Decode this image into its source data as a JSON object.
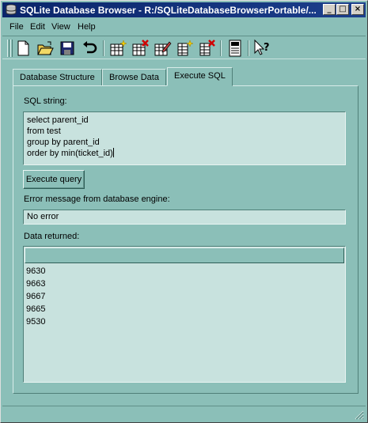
{
  "window": {
    "title": "SQLite Database Browser - R:/SQLiteDatabaseBrowserPortable/..."
  },
  "title_buttons": {
    "minimize": "_",
    "maximize": "□",
    "close": "×"
  },
  "menu": [
    "File",
    "Edit",
    "View",
    "Help"
  ],
  "toolbar": {
    "icons": [
      "new-database-icon",
      "open-database-icon",
      "save-icon",
      "undo-icon",
      "create-table-icon",
      "delete-table-icon",
      "modify-table-icon",
      "create-index-icon",
      "delete-index-icon",
      "log-icon",
      "whats-this-icon"
    ]
  },
  "tabs": [
    {
      "label": "Database Structure",
      "active": false
    },
    {
      "label": "Browse Data",
      "active": false
    },
    {
      "label": "Execute SQL",
      "active": true
    }
  ],
  "execute_sql": {
    "sql_label": "SQL string:",
    "sql_lines": [
      "select parent_id",
      "from test",
      "group by parent_id",
      "order by min(ticket_id)"
    ],
    "execute_button": "Execute query",
    "error_label": "Error message from database engine:",
    "error_value": "No error",
    "data_label": "Data returned:",
    "rows": [
      "9630",
      "9663",
      "9667",
      "9665",
      "9530"
    ]
  },
  "colors": {
    "background": "#8bbfb8",
    "field": "#c8e2de",
    "titlebar": "#0a246a"
  }
}
